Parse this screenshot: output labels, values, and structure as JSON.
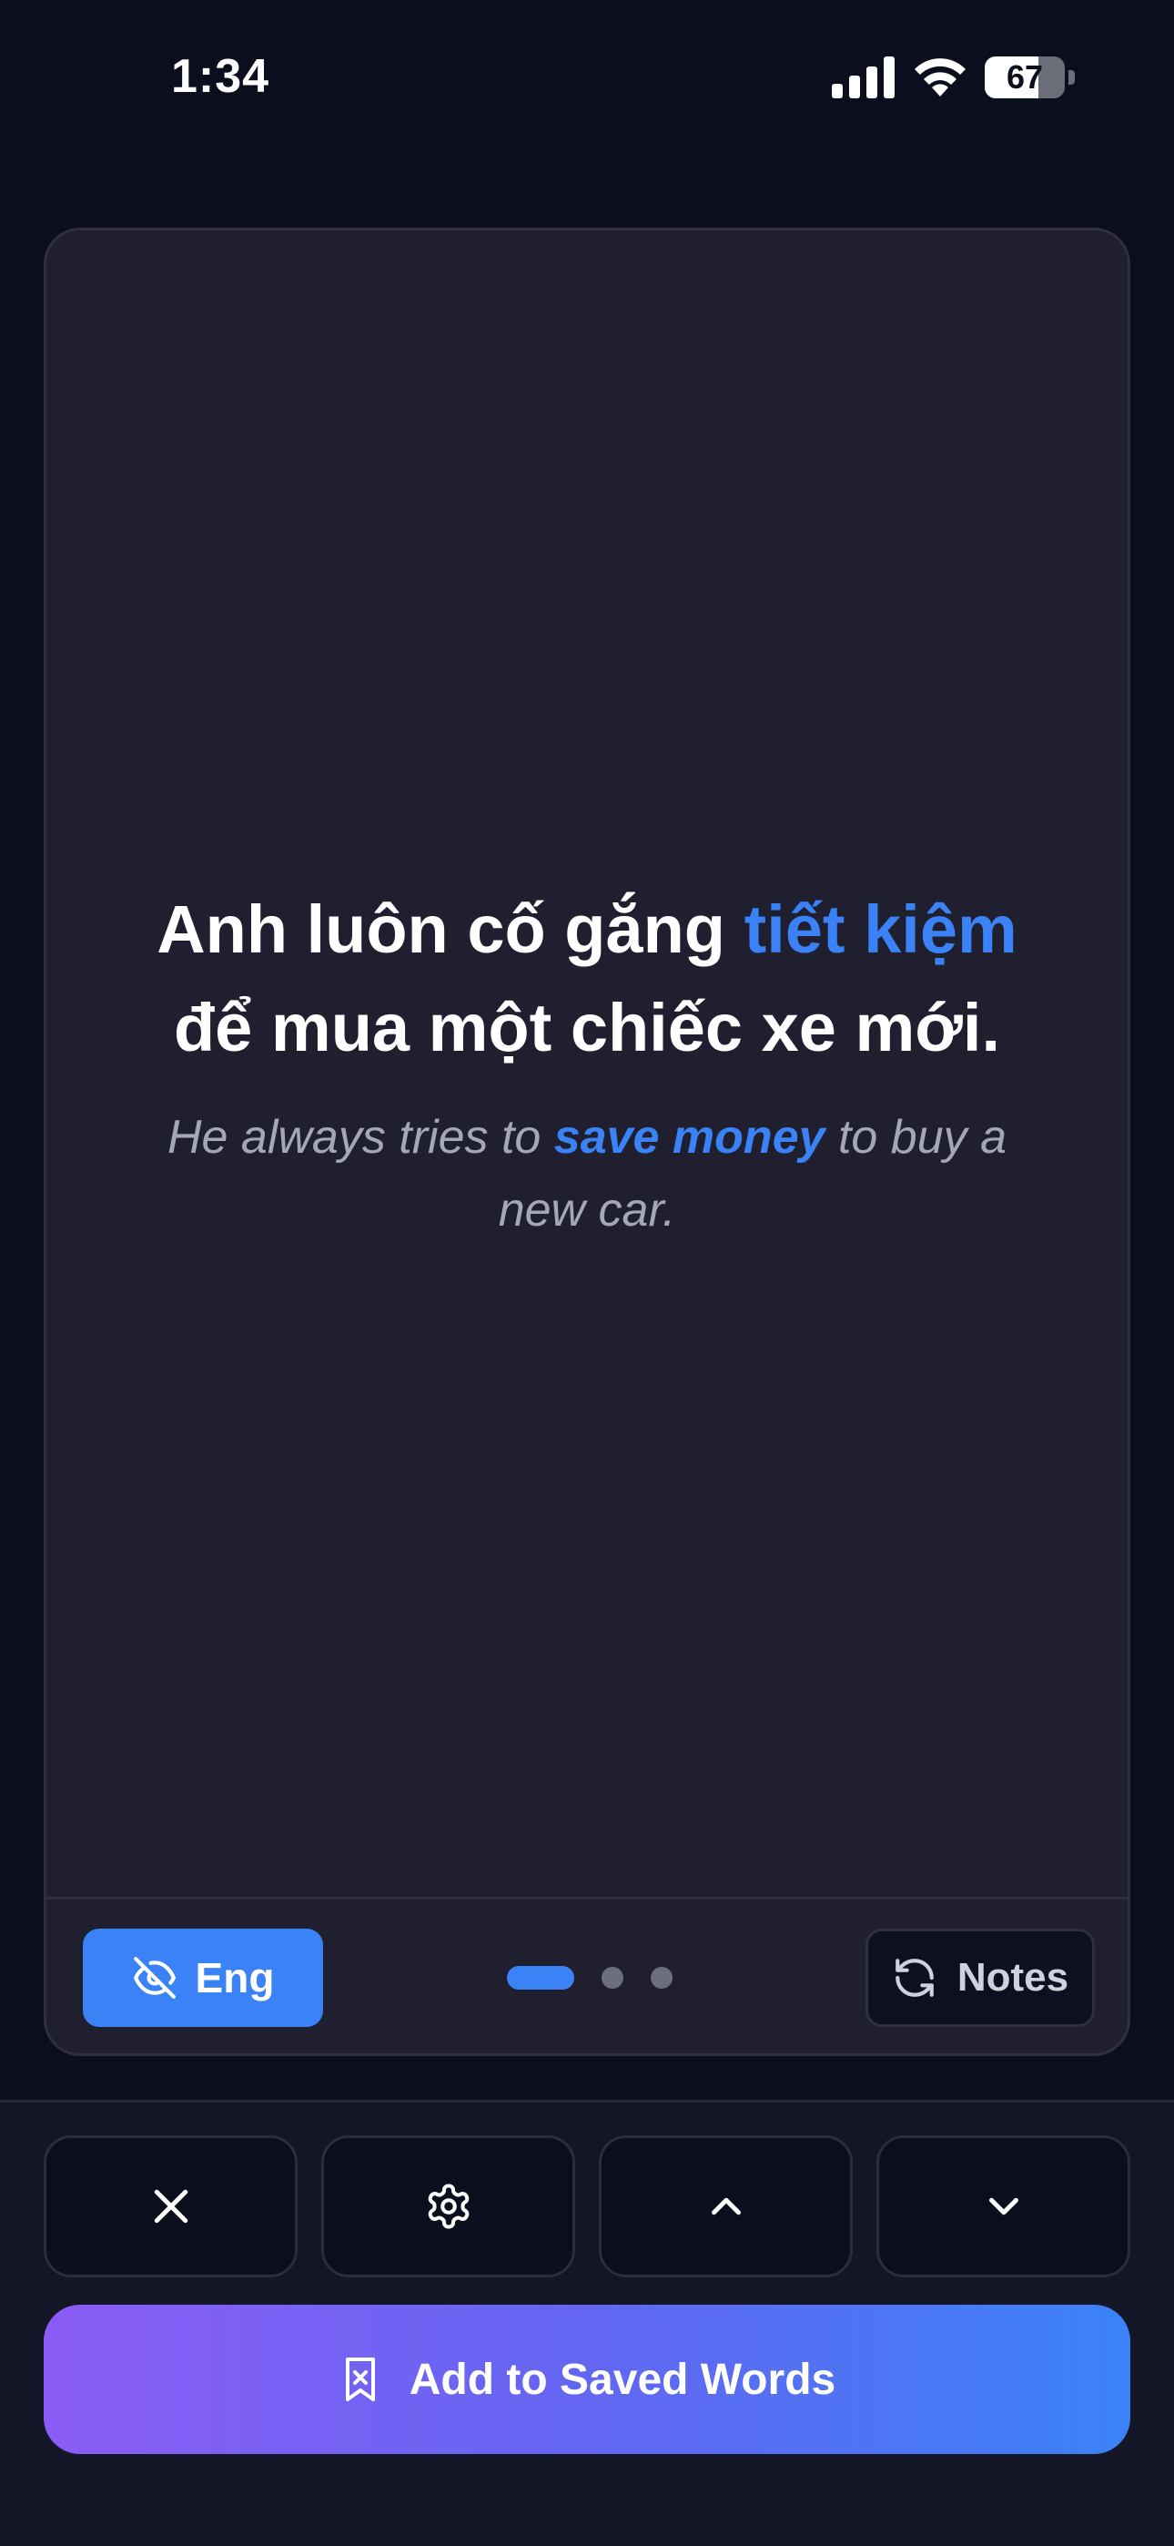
{
  "status_bar": {
    "time": "1:34",
    "battery_level": "67",
    "battery_fraction": 0.67
  },
  "card": {
    "sentence_before": "Anh luôn cố gắng ",
    "sentence_highlight": "tiết kiệm",
    "sentence_after": " để mua một chiếc xe mới.",
    "translation_before": "He always tries to ",
    "translation_highlight": "save money",
    "translation_after": " to buy a new car.",
    "language_toggle_label": "Eng",
    "notes_label": "Notes",
    "pager": {
      "total": 3,
      "active_index": 0
    }
  },
  "actions": {
    "close_icon": "close-icon",
    "settings_icon": "gear-icon",
    "up_icon": "chevron-up-icon",
    "down_icon": "chevron-down-icon"
  },
  "save_button": {
    "label": "Add to Saved Words",
    "icon": "bookmark-icon"
  },
  "colors": {
    "background": "#0b0e1c",
    "card": "#1f1f2f",
    "accent": "#3b82f6",
    "gradient_start": "#8b5cf6",
    "gradient_end": "#3b82f6"
  }
}
